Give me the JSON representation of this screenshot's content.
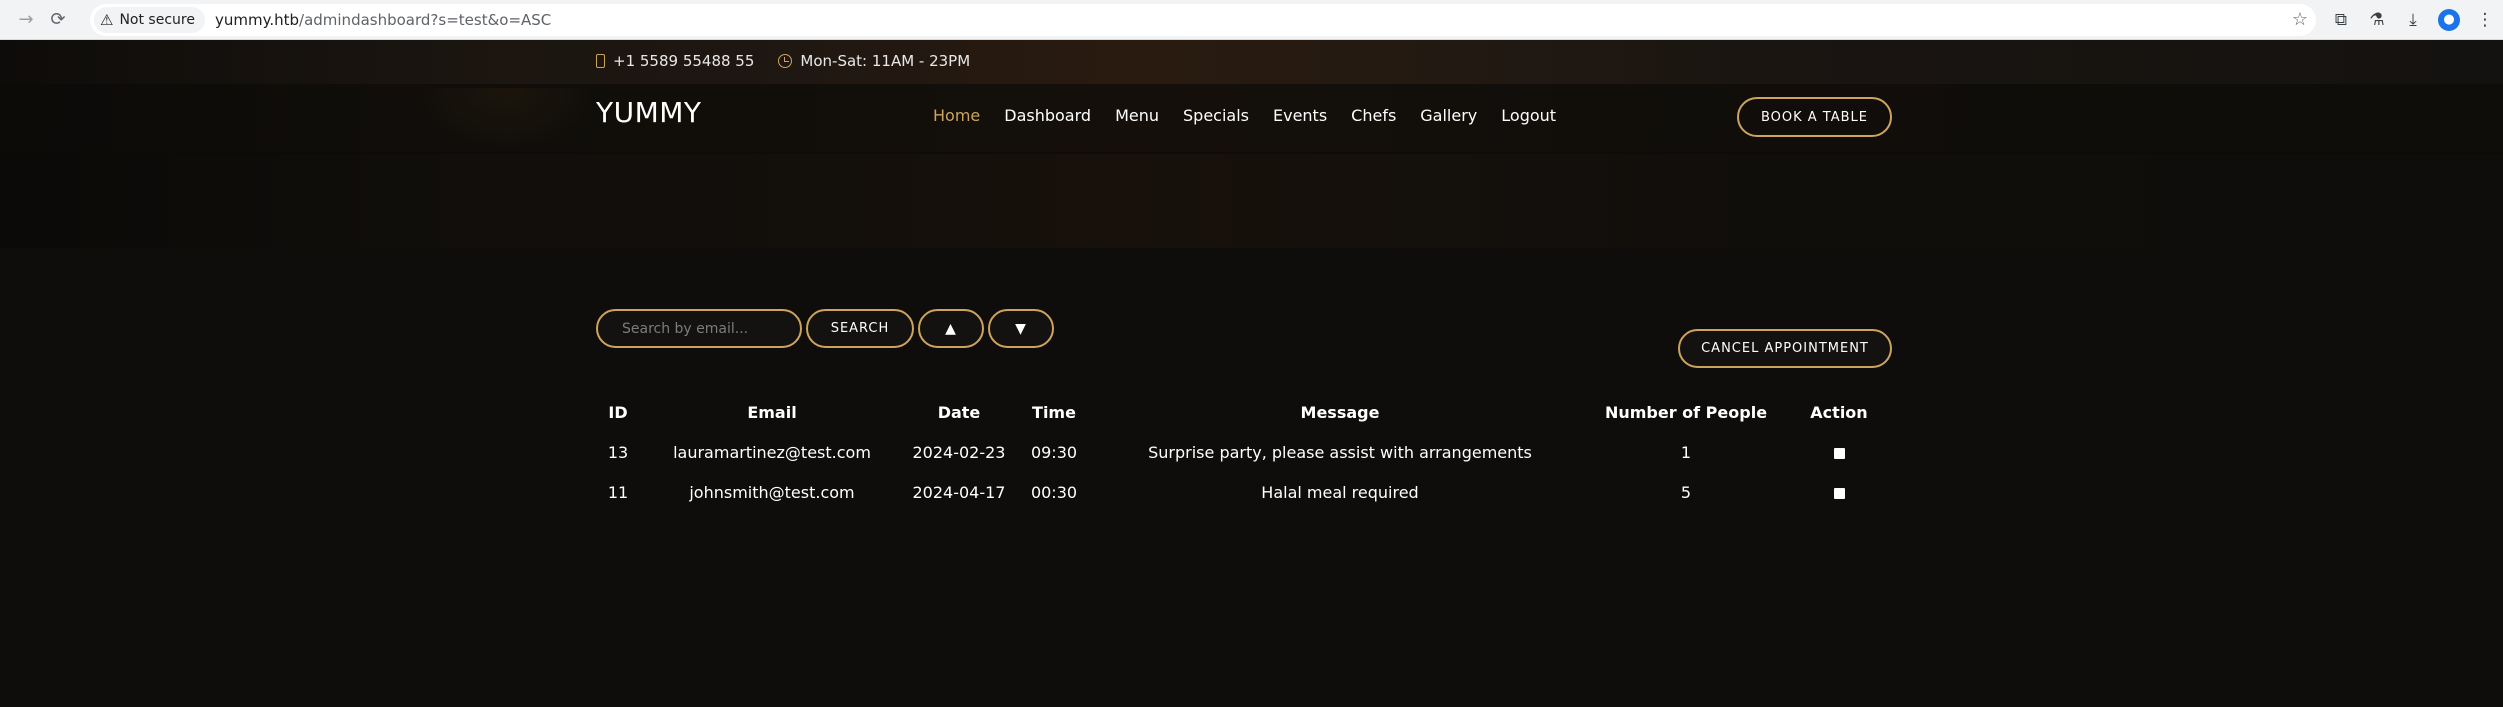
{
  "browser": {
    "security_label": "Not secure",
    "url_host": "yummy.htb",
    "url_path": "/admindashboard?s=test&o=ASC"
  },
  "topbar": {
    "phone": "+1 5589 55488 55",
    "hours": "Mon-Sat: 11AM - 23PM"
  },
  "header": {
    "logo": "YUMMY",
    "nav": [
      "Home",
      "Dashboard",
      "Menu",
      "Specials",
      "Events",
      "Chefs",
      "Gallery",
      "Logout"
    ],
    "active_nav": "Home",
    "book_label": "BOOK A TABLE"
  },
  "controls": {
    "search_placeholder": "Search by email...",
    "search_label": "SEARCH",
    "sort_up_label": "▲",
    "sort_down_label": "▼",
    "cancel_label": "CANCEL APPOINTMENT"
  },
  "table": {
    "headers": [
      "ID",
      "Email",
      "Date",
      "Time",
      "Message",
      "Number of People",
      "Action"
    ],
    "rows": [
      {
        "id": "13",
        "email": "lauramartinez@test.com",
        "date": "2024-02-23",
        "time": "09:30",
        "message": "Surprise party, please assist with arrangements",
        "people": "1"
      },
      {
        "id": "11",
        "email": "johnsmith@test.com",
        "date": "2024-04-17",
        "time": "00:30",
        "message": "Halal meal required",
        "people": "5"
      }
    ]
  },
  "colors": {
    "accent": "#cda45e",
    "background": "#0f0d0b"
  },
  "icons": {
    "phone": "phone-icon",
    "hours": "clock-icon"
  }
}
